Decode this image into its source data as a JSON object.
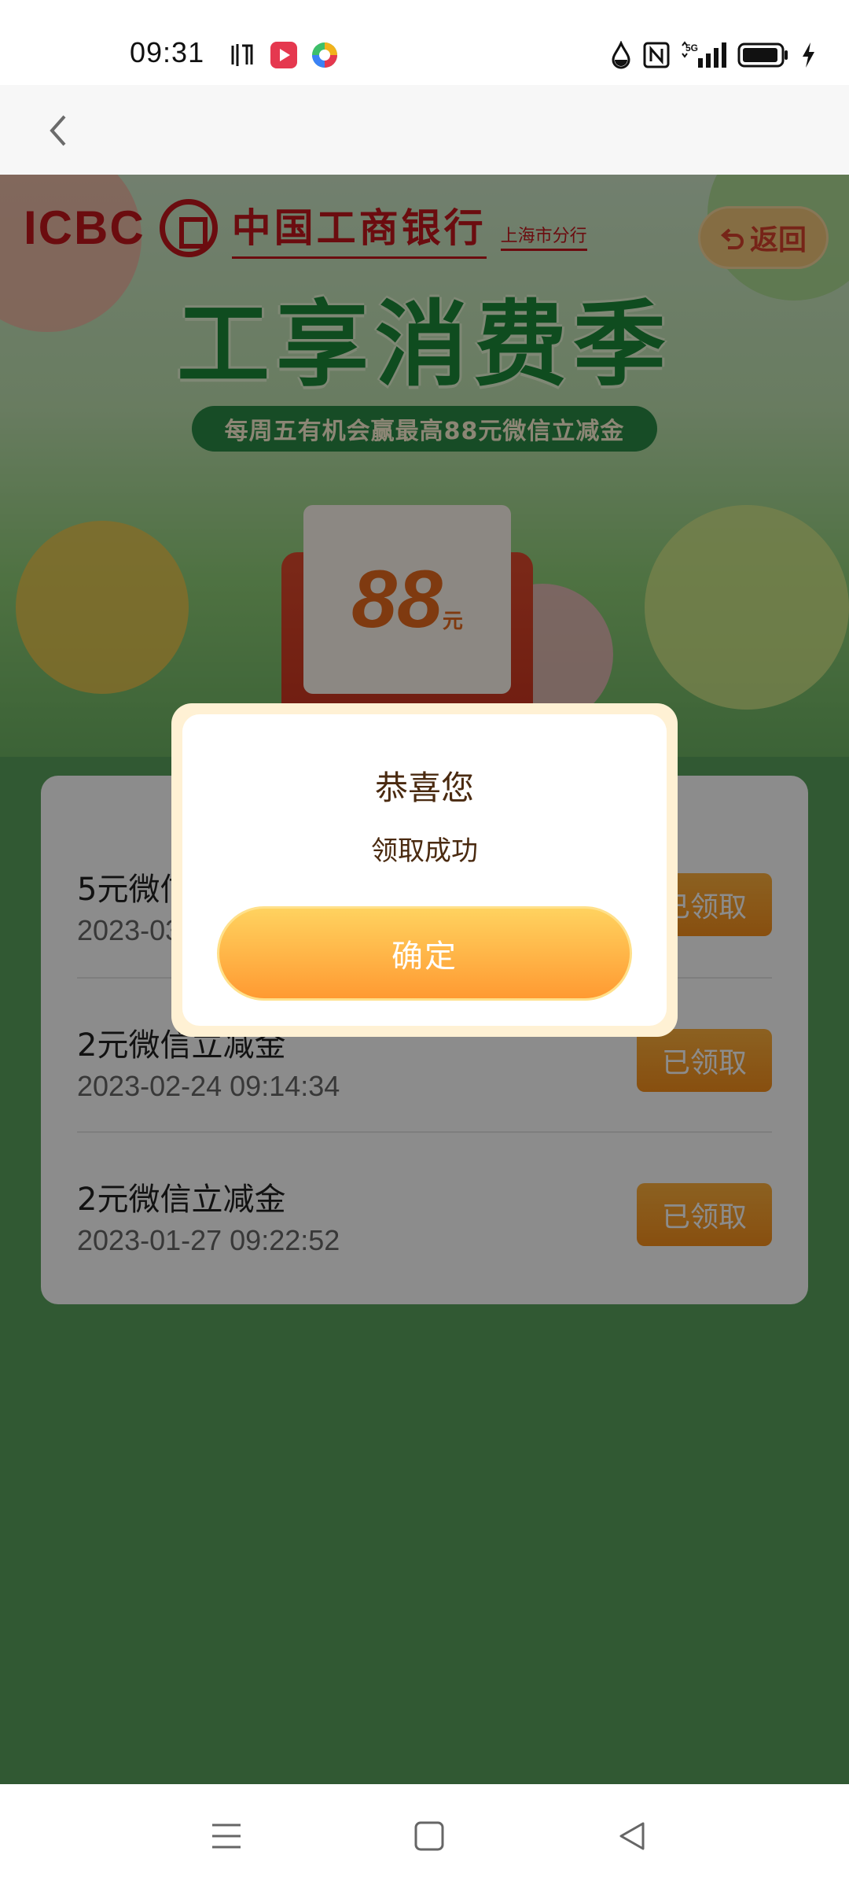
{
  "status_bar": {
    "time": "09:31",
    "icons_left": [
      "listen-icon",
      "video-app-icon",
      "colorful-app-icon"
    ],
    "icons_right": [
      "drop-icon",
      "nfc-icon",
      "5g-signal-icon",
      "battery-icon",
      "charging-icon"
    ],
    "signal_label": "5G"
  },
  "nav": {
    "back_icon": "chevron-left-icon"
  },
  "banner": {
    "brand_en": "ICBC",
    "brand_cn": "中国工商银行",
    "branch": "上海市分行",
    "return_label": "返回",
    "title": "工享消费季",
    "subtitle": "每周五有机会赢最高88元微信立减金",
    "prize_amount": "88",
    "prize_unit": "元"
  },
  "records": [
    {
      "title": "5元微信立减金",
      "time": "2023-03-03  09:31:02",
      "button": "已领取"
    },
    {
      "title": "2元微信立减金",
      "time": "2023-02-24  09:14:34",
      "button": "已领取"
    },
    {
      "title": "2元微信立减金",
      "time": "2023-01-27  09:22:52",
      "button": "已领取"
    }
  ],
  "modal": {
    "title": "恭喜您",
    "message": "领取成功",
    "confirm_label": "确定"
  },
  "bottom_nav": [
    "menu-icon",
    "home-square-icon",
    "back-triangle-icon"
  ],
  "colors": {
    "accent_orange": "#ff9a32",
    "bank_red": "#c4161c",
    "bg_green": "#5aa35d"
  }
}
